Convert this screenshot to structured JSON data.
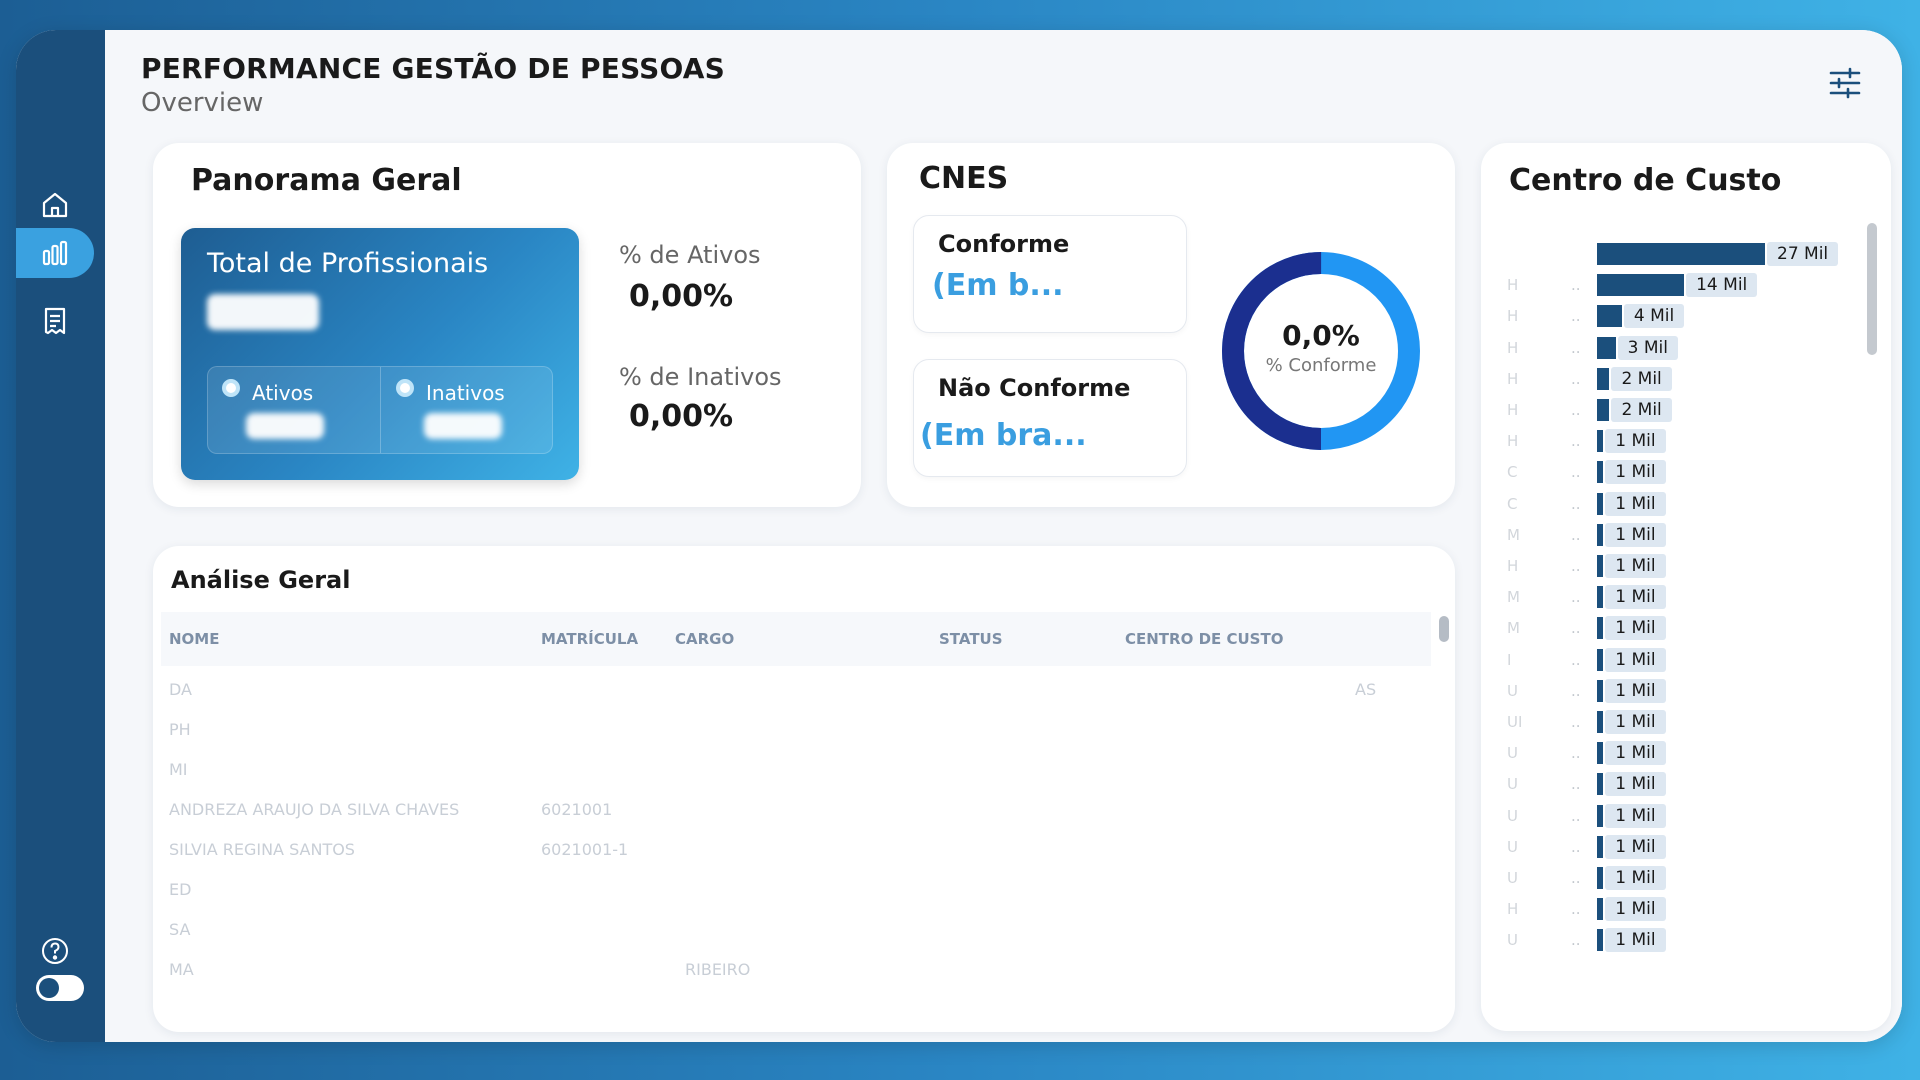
{
  "header": {
    "title": "PERFORMANCE GESTÃO DE PESSOAS",
    "subtitle": "Overview"
  },
  "sidebar": {
    "items": [
      {
        "icon": "home-icon",
        "active": false
      },
      {
        "icon": "bar-chart-icon",
        "active": true
      },
      {
        "icon": "report-icon",
        "active": false
      }
    ],
    "help_icon": "help-icon",
    "toggle_state": "off"
  },
  "panorama": {
    "title": "Panorama Geral",
    "total_label": "Total de Profissionais",
    "legend": [
      {
        "label": "Ativos"
      },
      {
        "label": "Inativos"
      }
    ],
    "ativos_label": "% de Ativos",
    "ativos_value": "0,00%",
    "inativos_label": "% de Inativos",
    "inativos_value": "0,00%"
  },
  "cnes": {
    "title": "CNES",
    "conforme_label": "Conforme",
    "conforme_value": "(Em b...",
    "nao_conforme_label": "Não Conforme",
    "nao_conforme_value": "(Em bra...",
    "donut_value": "0,0%",
    "donut_label": "% Conforme",
    "donut_fraction": 0.5,
    "colors": {
      "dark": "#1b2f8f",
      "light": "#2196f3"
    }
  },
  "analise": {
    "title": "Análise Geral",
    "columns": [
      "NOME",
      "MATRÍCULA",
      "CARGO",
      "STATUS",
      "CENTRO DE CUSTO"
    ],
    "rows": [
      {
        "nome": "DA",
        "matricula": "",
        "extra": "AS"
      },
      {
        "nome": "PH",
        "matricula": "",
        "extra": ""
      },
      {
        "nome": "MI",
        "matricula": "",
        "extra": ""
      },
      {
        "nome": "ANDREZA ARAUJO DA SILVA CHAVES",
        "matricula": "6021001",
        "extra": ""
      },
      {
        "nome": "SILVIA REGINA SANTOS",
        "matricula": "6021001-1",
        "extra": ""
      },
      {
        "nome": "ED",
        "matricula": "",
        "extra": ""
      },
      {
        "nome": "SA",
        "matricula": "",
        "extra": ""
      },
      {
        "nome": "MA",
        "matricula": "",
        "extra": "RIBEIRO"
      }
    ]
  },
  "centro": {
    "title": "Centro de Custo",
    "chart_data": {
      "type": "bar",
      "orientation": "horizontal",
      "categories": [
        "H",
        "H",
        "H",
        "H",
        "H",
        "H",
        "C",
        "C",
        "M",
        "H",
        "M",
        "M",
        "I",
        "U",
        "UI",
        "U",
        "U",
        "U",
        "U",
        "U",
        "H",
        "U"
      ],
      "values": [
        27000,
        14000,
        4000,
        3000,
        2000,
        2000,
        1000,
        1000,
        1000,
        1000,
        1000,
        1000,
        1000,
        1000,
        1000,
        1000,
        1000,
        1000,
        1000,
        1000,
        1000,
        1000,
        1000
      ],
      "labels": [
        "27 Mil",
        "14 Mil",
        "4 Mil",
        "3 Mil",
        "2 Mil",
        "2 Mil",
        "1 Mil",
        "1 Mil",
        "1 Mil",
        "1 Mil",
        "1 Mil",
        "1 Mil",
        "1 Mil",
        "1 Mil",
        "1 Mil",
        "1 Mil",
        "1 Mil",
        "1 Mil",
        "1 Mil",
        "1 Mil",
        "1 Mil",
        "1 Mil",
        "1 Mil"
      ],
      "bar_color": "#1b4f7c"
    }
  }
}
